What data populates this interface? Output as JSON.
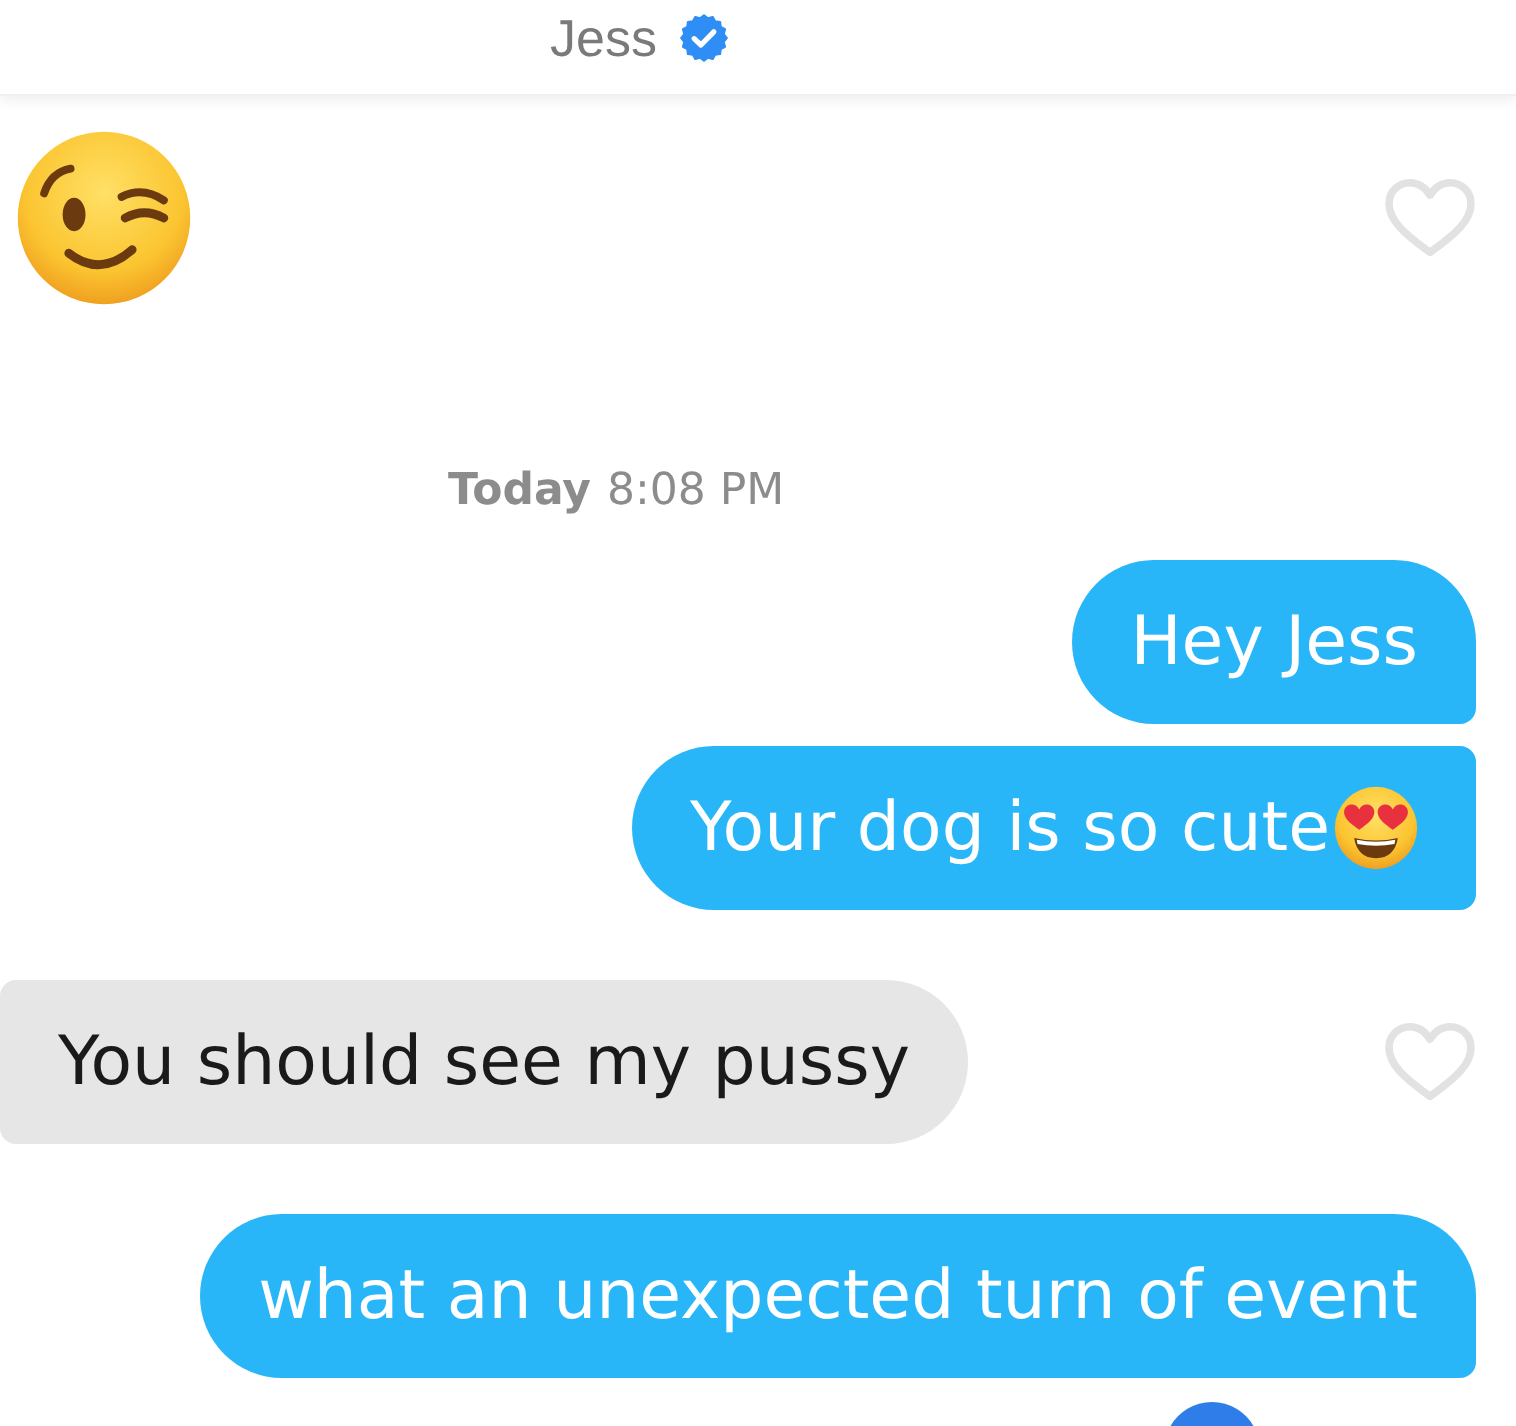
{
  "header": {
    "title": "Jess",
    "verified": true
  },
  "thread": [
    {
      "kind": "emoji",
      "outgoing": false,
      "liked": false
    },
    {
      "kind": "timestamp",
      "day": "Today",
      "time": "8:08 PM"
    },
    {
      "kind": "text",
      "outgoing": true,
      "text": "Hey Jess",
      "trailing_emoji": false
    },
    {
      "kind": "text",
      "outgoing": true,
      "text": "Your dog is so cute",
      "trailing_emoji": true
    },
    {
      "kind": "text",
      "outgoing": false,
      "text": "You should see my pussy",
      "trailing_emoji": false,
      "liked": false
    },
    {
      "kind": "text",
      "outgoing": true,
      "text": "what an unexpected turn of event",
      "trailing_emoji": false
    }
  ]
}
